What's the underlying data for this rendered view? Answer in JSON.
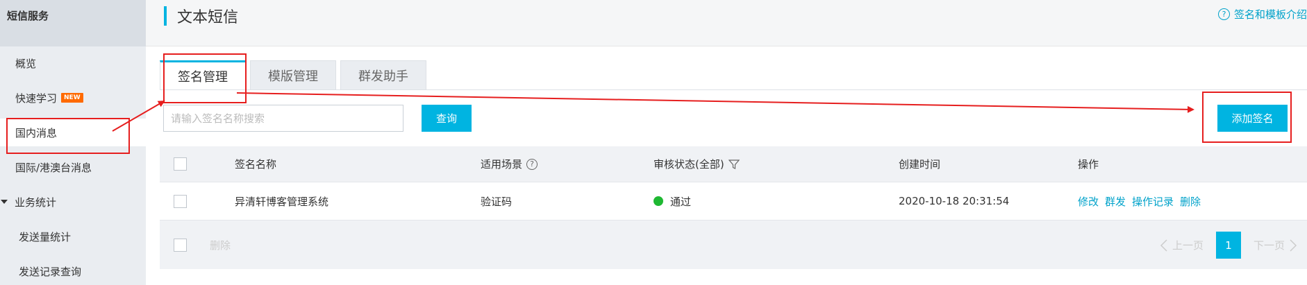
{
  "sidebar": {
    "header": "短信服务",
    "items": [
      {
        "label": "概览"
      },
      {
        "label": "快速学习",
        "badge": "NEW"
      },
      {
        "label": "国内消息"
      },
      {
        "label": "国际/港澳台消息"
      },
      {
        "label": "业务统计"
      },
      {
        "label": "发送量统计"
      },
      {
        "label": "发送记录查询"
      }
    ]
  },
  "header": {
    "title": "文本短信",
    "help_icon": "?",
    "help_link": "签名和模板介绍"
  },
  "tabs": [
    {
      "label": "签名管理",
      "active": true
    },
    {
      "label": "模版管理",
      "active": false
    },
    {
      "label": "群发助手",
      "active": false
    }
  ],
  "search": {
    "placeholder": "请输入签名名称搜索",
    "value": "",
    "button": "查询"
  },
  "add_button": "添加签名",
  "table": {
    "columns": [
      "签名名称",
      "适用场景",
      "审核状态(全部)",
      "创建时间",
      "操作"
    ],
    "column_help_icon": "?",
    "rows": [
      {
        "name": "异清轩博客管理系统",
        "scene": "验证码",
        "status": "通过",
        "created": "2020-10-18 20:31:54",
        "actions": [
          "修改",
          "群发",
          "操作记录",
          "删除"
        ]
      }
    ]
  },
  "footer": {
    "delete_label": "删除",
    "prev_label": "上一页",
    "current_page": "1",
    "next_label": "下一页"
  },
  "colors": {
    "accent": "#00b4e1",
    "link": "#00a2ca",
    "status_ok": "#1fb832",
    "annotation": "#e61e1e"
  }
}
